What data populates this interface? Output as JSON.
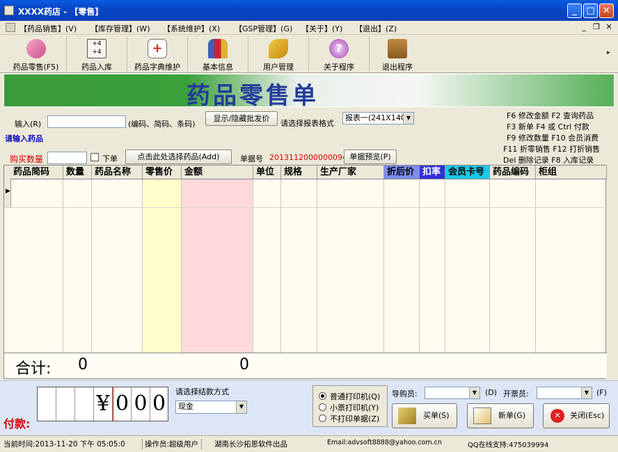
{
  "window": {
    "title": "XXXX药店 - 【零售】"
  },
  "menu": [
    {
      "label": "【药品销售】",
      "key": "V"
    },
    {
      "label": "【库存管理】",
      "key": "W"
    },
    {
      "label": "【系统维护】",
      "key": "X"
    },
    {
      "label": "【GSP管理】",
      "key": "G"
    },
    {
      "label": "【关于】",
      "key": "Y"
    },
    {
      "label": "【退出】",
      "key": "Z"
    }
  ],
  "toolbar": [
    {
      "label": "药品零售(F5)",
      "icon": "pill-icon"
    },
    {
      "label": "药品入库",
      "icon": "calculator-icon"
    },
    {
      "label": "药品字典维护",
      "icon": "first-aid-kit-icon"
    },
    {
      "label": "基本信息",
      "icon": "people-icon"
    },
    {
      "label": "用户管理",
      "icon": "keys-icon"
    },
    {
      "label": "关于程序",
      "icon": "help-icon"
    },
    {
      "label": "退出程序",
      "icon": "exit-sign-icon"
    }
  ],
  "banner": {
    "title": "药品零售单"
  },
  "form": {
    "input_label": "输入(R)",
    "input_hint": "(编码、简码、条码)",
    "toggle_batch_price": "显示/隐藏批发价",
    "report_format_label": "请选择报表格式",
    "report_format_value": "报表一(241X140",
    "prompt": "请输入药品",
    "qty_label": "购买数量",
    "below_label": "下单",
    "select_drug_button": "点击此处选择药品(Add)",
    "receipt_no_label": "单据号",
    "receipt_no": "2013112000000094",
    "preview_button": "单据预览(P)"
  },
  "hotkeys": [
    "F6 修改金额   F2 查询药品",
    "F3 新单    F4 或 Ctrl 付款",
    "F9 修改数量  F10 会员消费",
    "F11 折零销售 F12 打折销售",
    "Del 删除记录  F8 入库记录"
  ],
  "grid": {
    "columns": [
      {
        "label": "药品简码",
        "style": "normal"
      },
      {
        "label": "数量",
        "style": "normal"
      },
      {
        "label": "药品名称",
        "style": "normal"
      },
      {
        "label": "零售价",
        "style": "normal"
      },
      {
        "label": "金额",
        "style": "normal"
      },
      {
        "label": "单位",
        "style": "normal"
      },
      {
        "label": "规格",
        "style": "normal"
      },
      {
        "label": "生产厂家",
        "style": "normal"
      },
      {
        "label": "折后价",
        "style": "blue"
      },
      {
        "label": "扣率",
        "style": "blue"
      },
      {
        "label": "会员卡号",
        "style": "cyan"
      },
      {
        "label": "药品编码",
        "style": "normal"
      },
      {
        "label": "柜组",
        "style": "normal"
      }
    ],
    "sum_label": "合计:",
    "sum_qty": "0",
    "sum_amount": "0"
  },
  "payment": {
    "label": "付款:",
    "digits": [
      "",
      "",
      "",
      "¥",
      "0",
      "0",
      "0"
    ],
    "method_label": "请选择结款方式",
    "method_value": "现金"
  },
  "print_options": [
    {
      "label": "普通打印机(Q)",
      "checked": true
    },
    {
      "label": "小票打印机(Y)",
      "checked": false
    },
    {
      "label": "不打印单据(Z)",
      "checked": false
    }
  ],
  "staff": {
    "buyer_label": "导购员:",
    "buyer_key": "D",
    "issuer_label": "开票员:",
    "issuer_key": "F"
  },
  "actions": [
    {
      "label": "买单(S)",
      "icon": "cash-register-icon"
    },
    {
      "label": "新单(G)",
      "icon": "pencil-paper-icon"
    },
    {
      "label": "关闭(Esc)",
      "icon": "close-circle-icon"
    }
  ],
  "status": {
    "time": "当前时间:2013-11-20 下午 05:05:0",
    "operator": "操作员:超级用户",
    "company": "湖南长沙拓思软件出品",
    "email": "Email:advsoft8888@yahoo.com.cn",
    "qq": "QQ在线支持:475039994"
  },
  "colors": {
    "title_bar": "#0746c8",
    "banner_green": "#3aa03a",
    "price_col": "#ffffcc",
    "amount_col": "#ffd9dc",
    "red_text": "#d40000",
    "blue_text": "#1010c0"
  }
}
